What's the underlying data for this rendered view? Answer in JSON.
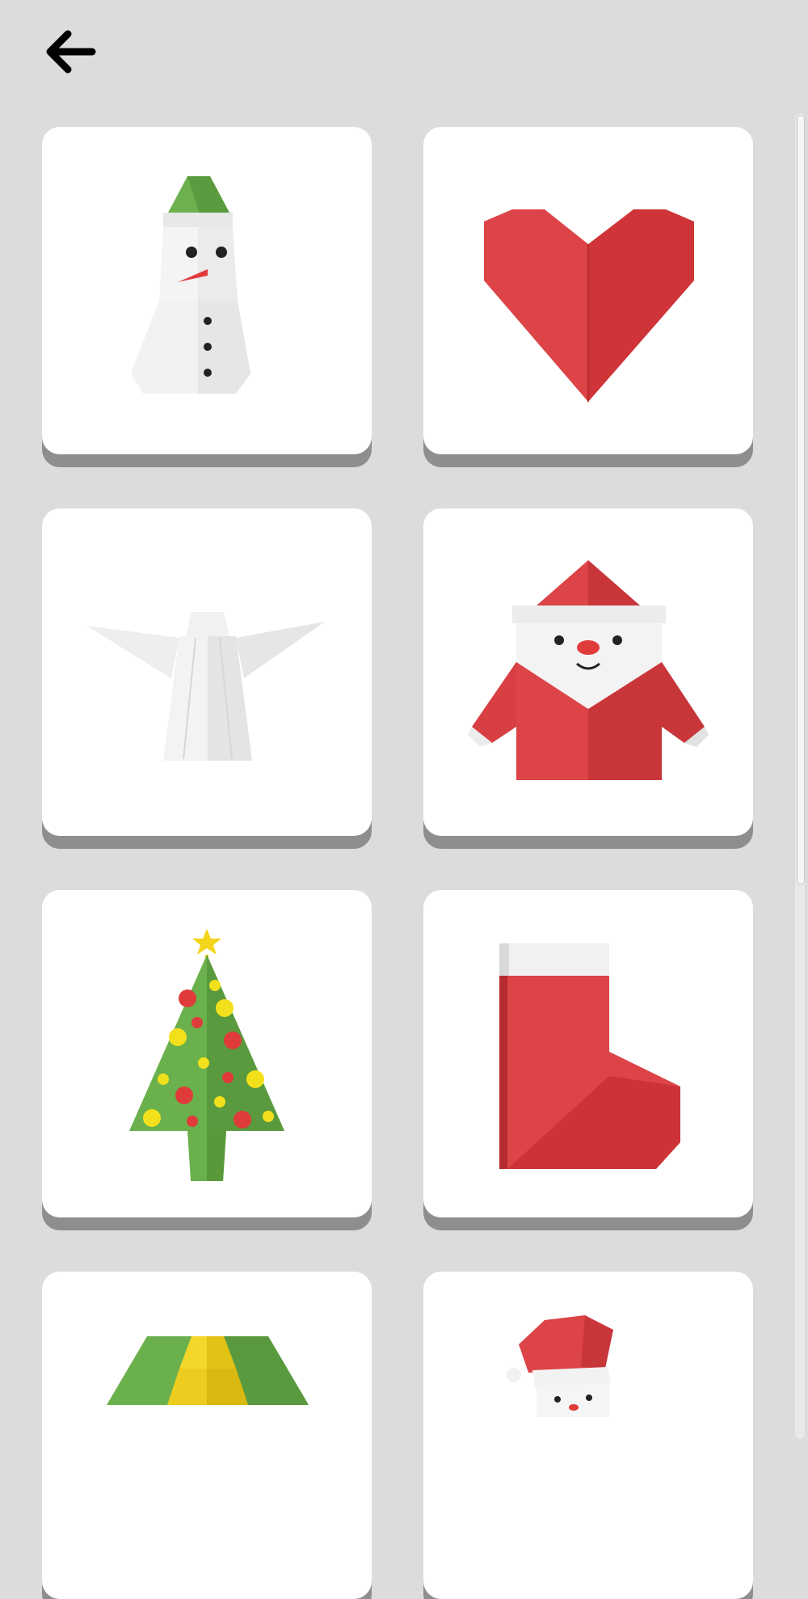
{
  "header": {
    "back_icon": "arrow-left-icon"
  },
  "colors": {
    "background": "#dcdcdc",
    "card": "#ffffff",
    "shadow": "#8e8e8e",
    "accent_red": "#d83a40",
    "accent_green": "#6ab04c"
  },
  "crafts": [
    {
      "id": "snowman",
      "icon": "snowman-icon"
    },
    {
      "id": "heart",
      "icon": "heart-icon"
    },
    {
      "id": "angel",
      "icon": "angel-icon"
    },
    {
      "id": "santa",
      "icon": "santa-icon"
    },
    {
      "id": "christmas-tree",
      "icon": "christmas-tree-icon"
    },
    {
      "id": "stocking",
      "icon": "stocking-icon"
    },
    {
      "id": "bell",
      "icon": "bell-icon"
    },
    {
      "id": "santa-hat-face",
      "icon": "santa-hat-face-icon"
    }
  ]
}
